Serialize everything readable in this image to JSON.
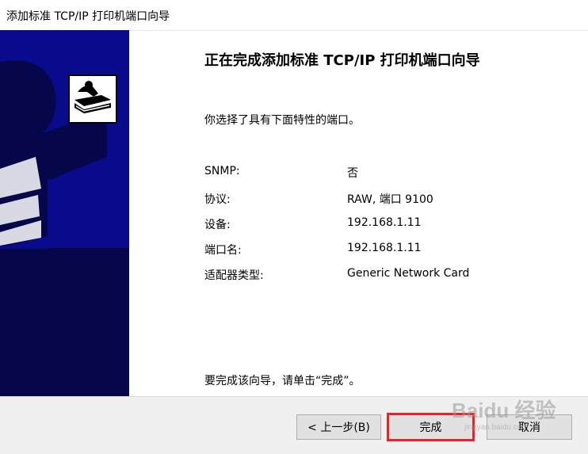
{
  "window": {
    "title": "添加标准 TCP/IP 打印机端口向导"
  },
  "main": {
    "heading": "正在完成添加标准 TCP/IP 打印机端口向导",
    "intro": "你选择了具有下面特性的端口。",
    "properties": [
      {
        "label": "SNMP:",
        "value": "否"
      },
      {
        "label": "协议:",
        "value": "RAW, 端口 9100"
      },
      {
        "label": "设备:",
        "value": "192.168.1.11"
      },
      {
        "label": "端口名:",
        "value": "192.168.1.11"
      },
      {
        "label": "适配器类型:",
        "value": "Generic Network Card"
      }
    ],
    "footer": "要完成该向导，请单击“完成”。"
  },
  "buttons": {
    "back": "< 上一步(B)",
    "finish": "完成",
    "cancel": "取消"
  },
  "watermark": {
    "text": "Baidu 经验",
    "sub": "jingyan.baidu.com"
  },
  "colors": {
    "side_panel": "#0a0a8c",
    "highlight": "#e8242a",
    "button_bar": "#f0f0f0"
  }
}
